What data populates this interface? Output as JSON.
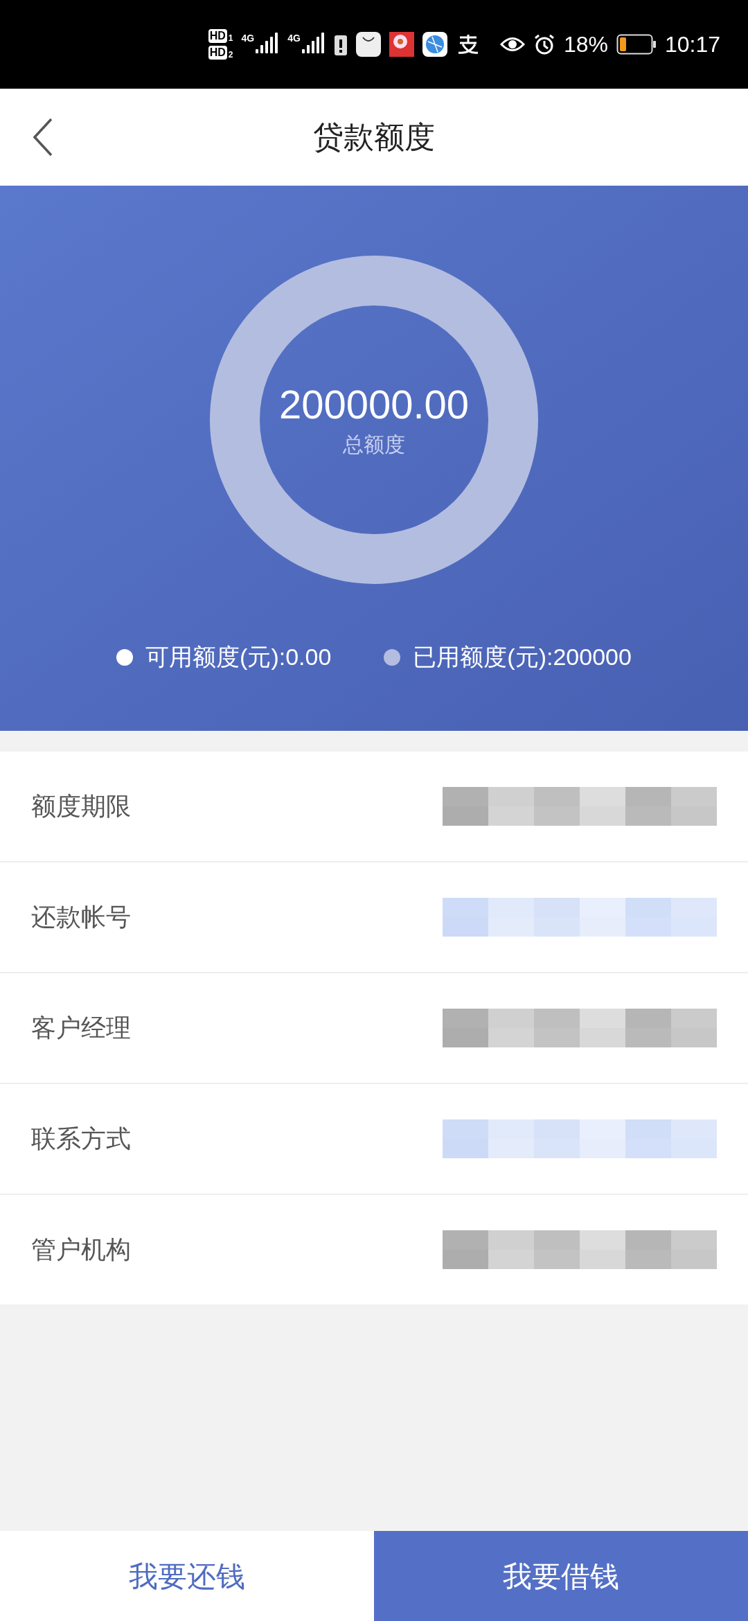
{
  "status_bar": {
    "sim_labels": [
      {
        "hd": "HD",
        "slot": "1",
        "network": "4G"
      },
      {
        "hd": "HD",
        "slot": "2",
        "network": "4G"
      }
    ],
    "battery_percent": "18%",
    "time": "10:17"
  },
  "header": {
    "title": "贷款额度"
  },
  "summary": {
    "amount": "200000.00",
    "amount_label": "总额度",
    "legend": [
      {
        "label": "可用额度(元):0.00",
        "color": "#ffffff"
      },
      {
        "label": "已用额度(元):200000",
        "color": "#b3bde0"
      }
    ]
  },
  "details": [
    {
      "label": "额度期限",
      "color": "#a9a9a9"
    },
    {
      "label": "还款帐号",
      "color": "#c9d8f7"
    },
    {
      "label": "客户经理",
      "color": "#a9a9a9"
    },
    {
      "label": "联系方式",
      "color": "#c9d8f7"
    },
    {
      "label": "管户机构",
      "color": "#a9a9a9"
    }
  ],
  "actions": [
    {
      "label": "我要还钱",
      "selected": false
    },
    {
      "label": "我要借钱",
      "selected": true
    }
  ]
}
